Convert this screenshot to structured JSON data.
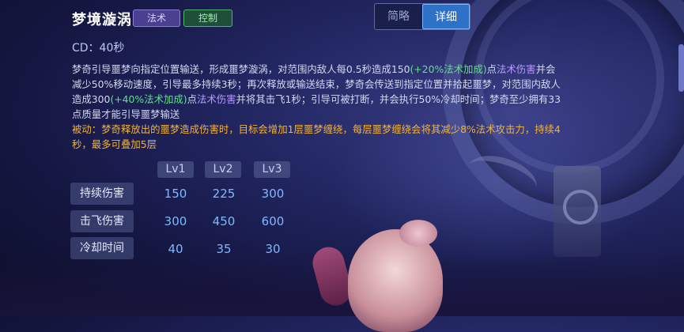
{
  "skill": {
    "name": "梦境漩涡",
    "tags": [
      "法术",
      "控制"
    ],
    "cd_text": "CD：40秒"
  },
  "view_toggle": {
    "brief_label": "简略",
    "detail_label": "详细",
    "selected": "详细"
  },
  "description": {
    "p1_a": "梦奇引导噩梦向指定位置输送，形成噩梦漩涡，对范围内敌人每0.5秒造成150",
    "p1_b": "(+20%法术加成)",
    "p1_c": "点",
    "p1_d": "法术伤害",
    "p1_e": "并会减少50%移动速度，引导最多持续3秒；再次释放或输送结束，梦奇会传送到指定位置并拾起噩梦，对范围内敌人造成300",
    "p1_f": "(+40%法术加成)",
    "p1_g": "点",
    "p1_h": "法术伤害",
    "p1_i": "并将其击飞1秒；引导可被打断，并会执行50%冷却时间；梦奇至少拥有33点质量才能引导噩梦输送",
    "passive": "被动：梦奇释放出的噩梦造成伤害时，目标会增加1层噩梦缠绕，每层噩梦缠绕会将其减少8%法术攻击力，持续4秒，最多可叠加5层"
  },
  "table": {
    "levels": [
      "Lv1",
      "Lv2",
      "Lv3"
    ],
    "rows": [
      {
        "label": "持续伤害",
        "values": [
          "150",
          "225",
          "300"
        ]
      },
      {
        "label": "击飞伤害",
        "values": [
          "300",
          "450",
          "600"
        ]
      },
      {
        "label": "冷却时间",
        "values": [
          "40",
          "35",
          "30"
        ]
      }
    ]
  },
  "colors": {
    "bonus_green": "#5fe08a",
    "magic_purple": "#b69cff",
    "passive_orange": "#f2b23c",
    "value_blue": "#7fb8ff",
    "selected_blue": "#2e72c8"
  }
}
